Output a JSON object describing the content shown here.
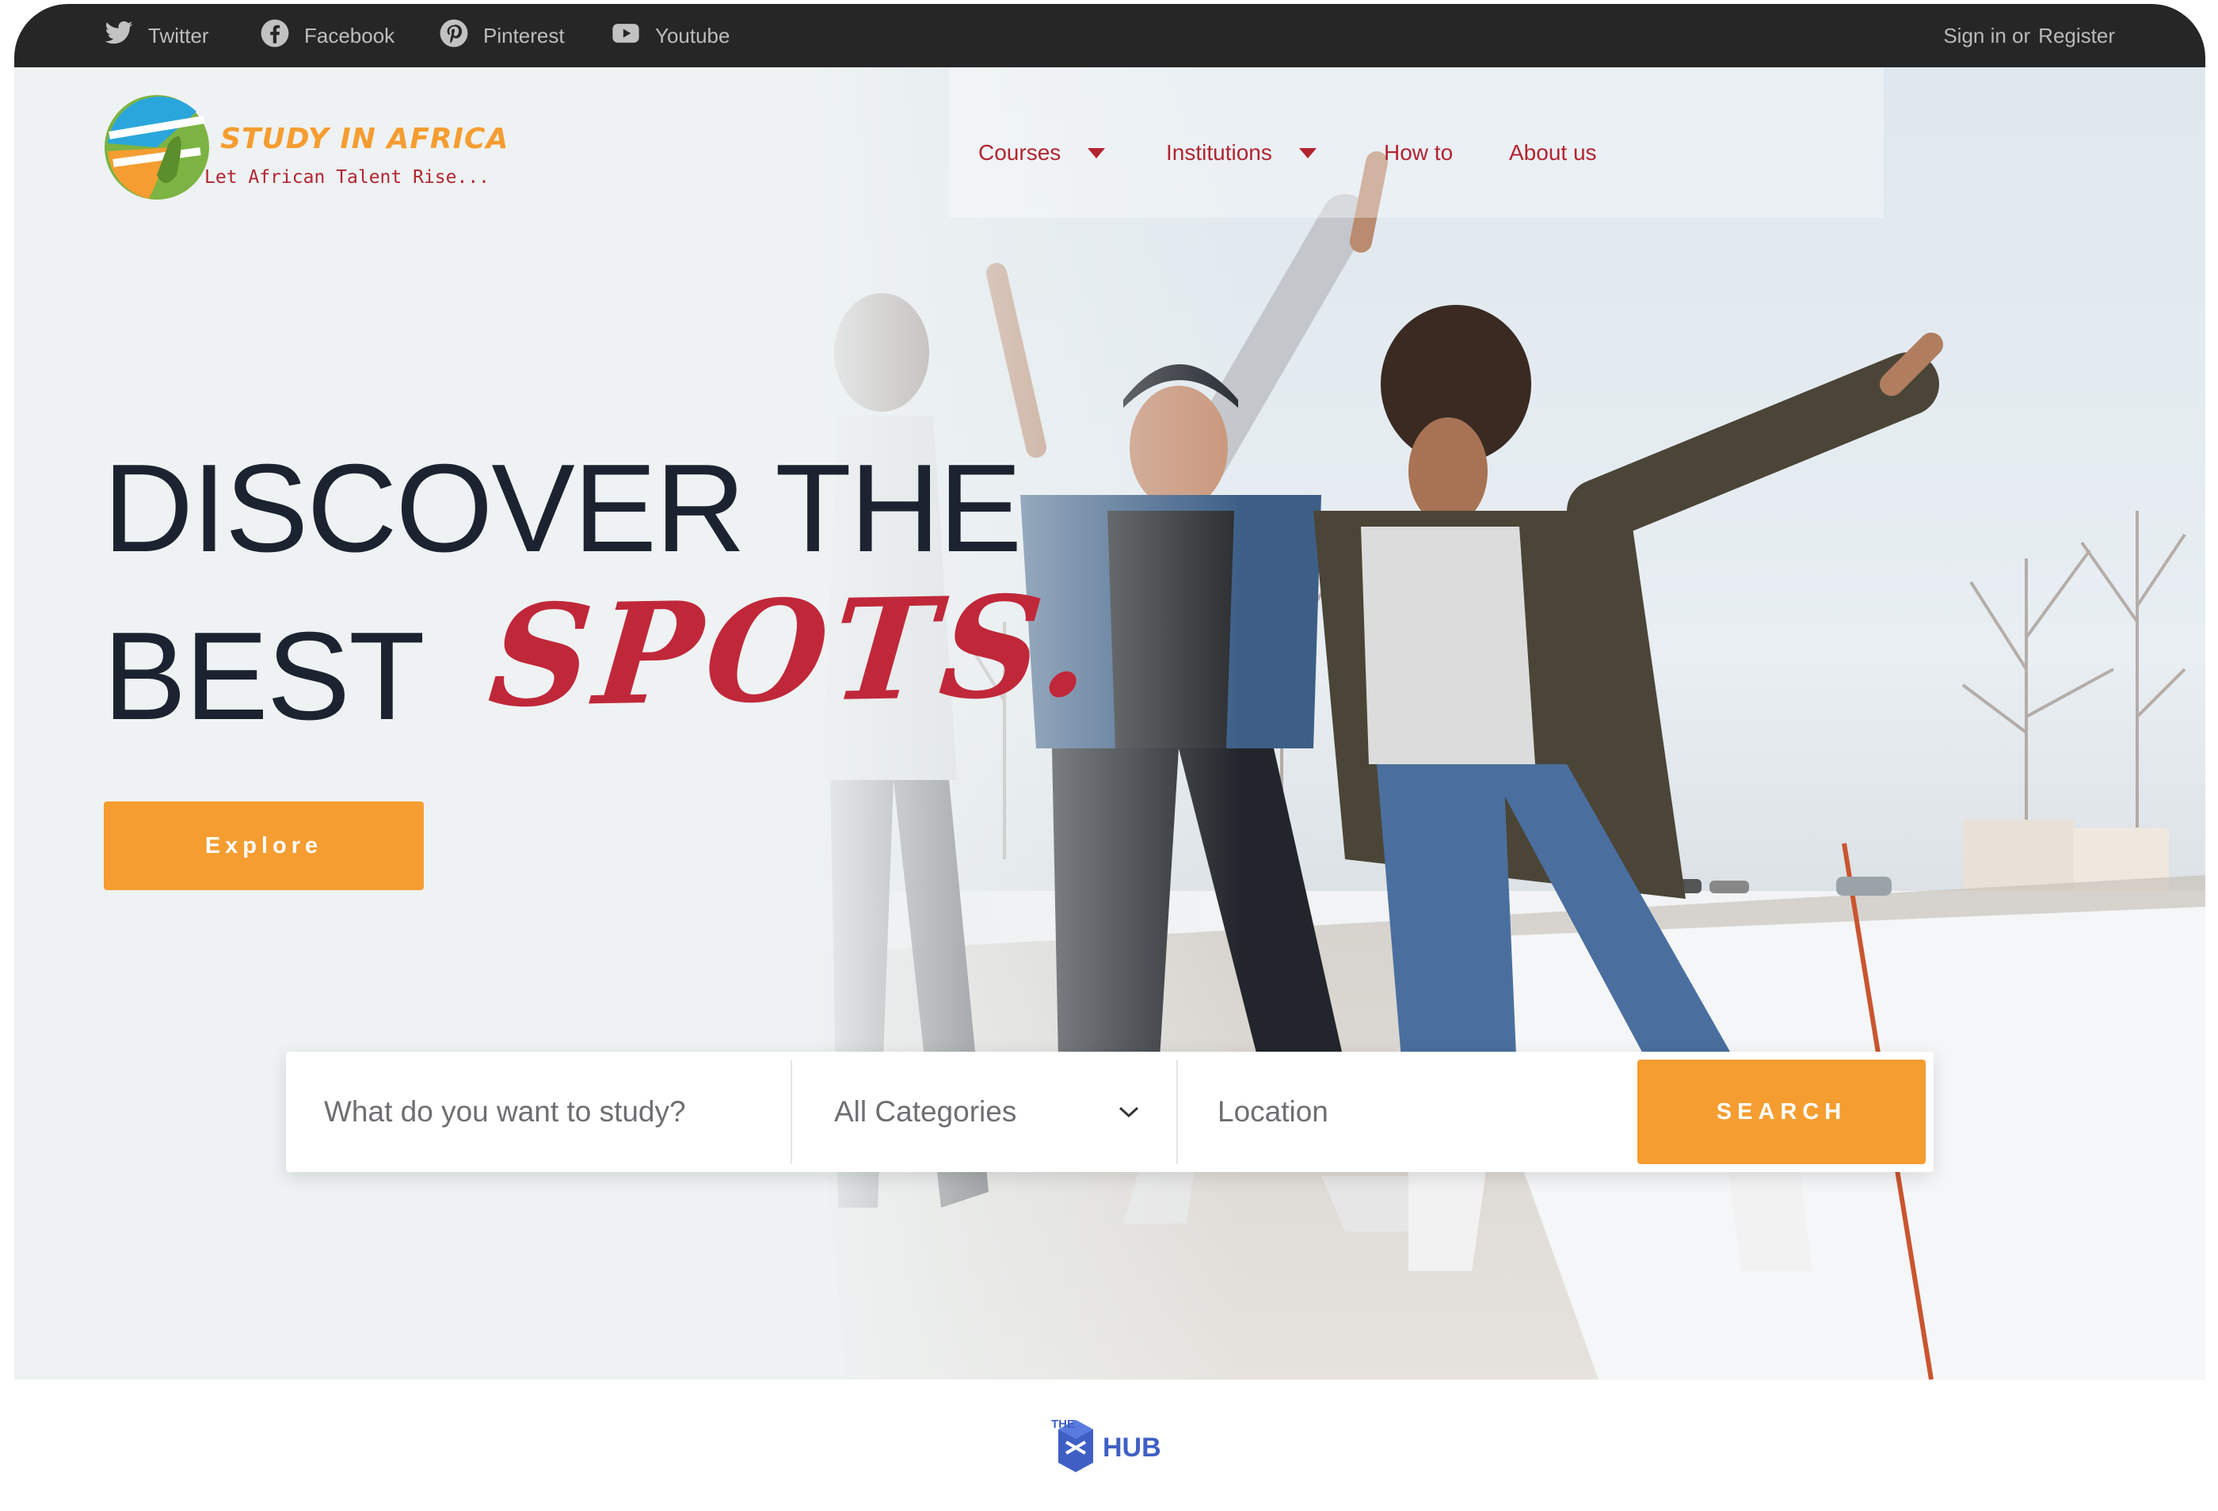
{
  "social_links": [
    {
      "label": "Twitter",
      "icon": "twitter-icon"
    },
    {
      "label": "Facebook",
      "icon": "facebook-icon"
    },
    {
      "label": "Pinterest",
      "icon": "pinterest-icon"
    },
    {
      "label": "Youtube",
      "icon": "youtube-icon"
    }
  ],
  "auth": {
    "sign_in": "Sign in or",
    "register": "Register"
  },
  "brand": {
    "name": "STUDY IN AFRICA",
    "tagline": "Let African Talent Rise...",
    "colors": {
      "orange": "#f59d31",
      "red": "#c0283a",
      "blue": "#2aa6dc",
      "green": "#7cb342"
    }
  },
  "nav": [
    {
      "label": "Courses",
      "has_dropdown": true
    },
    {
      "label": "Institutions",
      "has_dropdown": true
    },
    {
      "label": "How to",
      "has_dropdown": false
    },
    {
      "label": "About us",
      "has_dropdown": false
    }
  ],
  "hero": {
    "line1": "DISCOVER THE",
    "line2": "BEST",
    "highlight": "SPOTS.",
    "explore_label": "Explore"
  },
  "search": {
    "study_placeholder": "What do you want to study?",
    "category_value": "All Categories",
    "location_placeholder": "Location",
    "button_label": "SEARCH"
  },
  "footer_logo": {
    "text": "HUB",
    "prefix": "THE"
  },
  "colors": {
    "accent": "#f59d31",
    "nav_text": "#b22431",
    "heading": "#1c2330",
    "topbar": "#262626"
  }
}
